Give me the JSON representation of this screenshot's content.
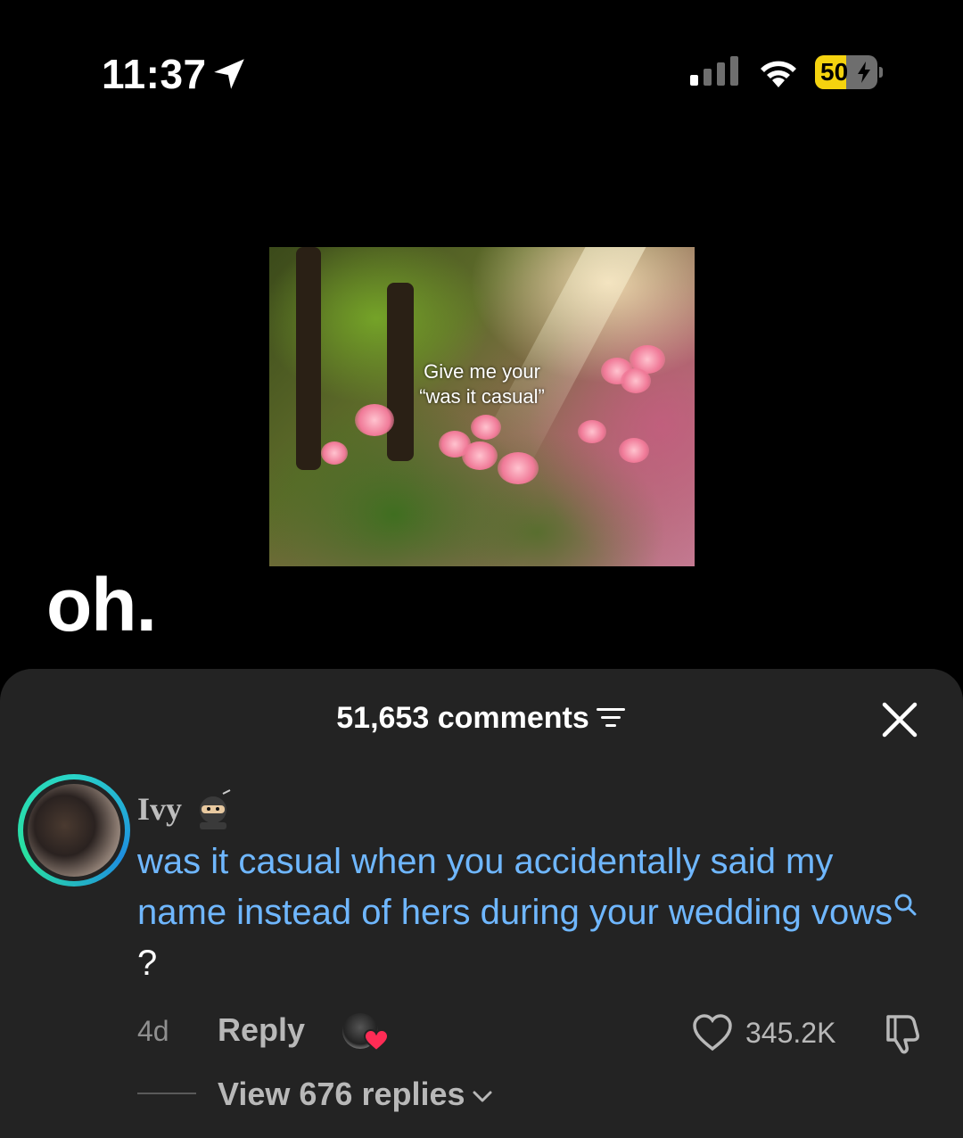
{
  "status_bar": {
    "time": "11:37",
    "battery_level": "50",
    "battery_fraction": 0.5,
    "battery_color": "#f5d30f"
  },
  "video": {
    "thumbnail_caption_line1": "Give me your",
    "thumbnail_caption_line2": "“was it casual”",
    "caption": "oh."
  },
  "comments": {
    "count_label": "51,653 comments",
    "comment": {
      "username": "Ivy",
      "text_main": "was it casual when you accidentally said my name instead of hers during your wedding vows",
      "text_end": "?",
      "time_ago": "4d",
      "reply_label": "Reply",
      "like_count": "345.2K",
      "view_replies_label": "View 676 replies",
      "link_color": "#6fb7ff"
    }
  },
  "icons": {
    "location": "location-arrow-icon",
    "signal": "cellular-signal-icon",
    "wifi": "wifi-icon",
    "filter": "filter-icon",
    "close": "close-icon",
    "search": "search-icon",
    "heart": "heart-icon",
    "dislike": "thumbs-down-icon"
  }
}
